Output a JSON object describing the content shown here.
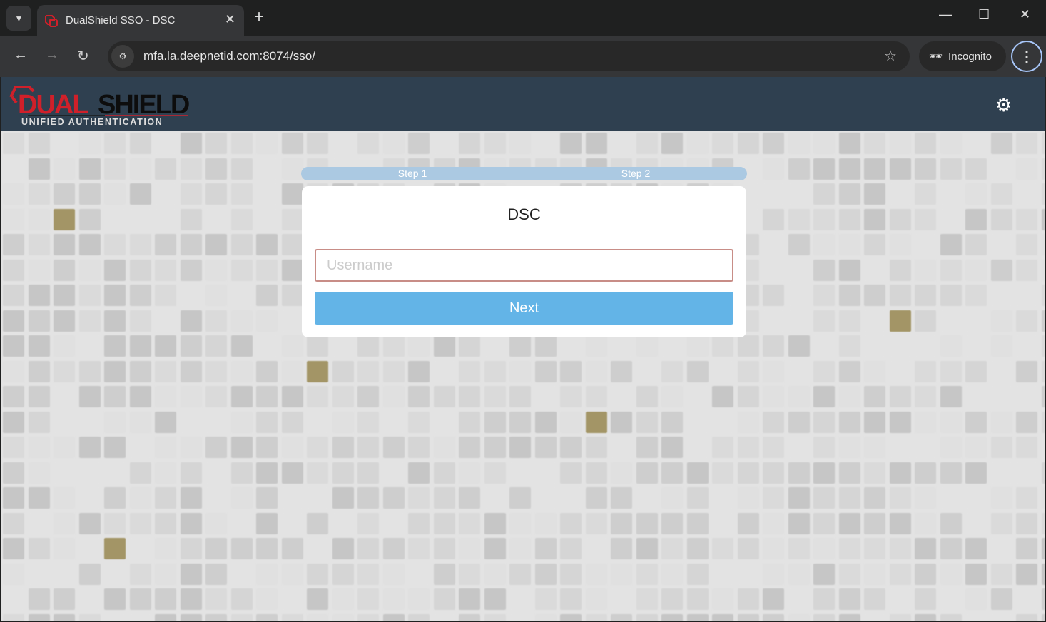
{
  "browser": {
    "tab_title": "DualShield SSO - DSC",
    "url": "mfa.la.deepnetid.com:8074/sso/",
    "incognito_label": "Incognito"
  },
  "header": {
    "logo_text": "DUALSHIELD",
    "logo_tagline": "UNIFIED AUTHENTICATION"
  },
  "steps": [
    "Step 1",
    "Step 2"
  ],
  "form": {
    "title": "DSC",
    "username_placeholder": "Username",
    "username_value": "",
    "next_label": "Next"
  },
  "colors": {
    "header": "#2f4050",
    "button": "#63b4e7",
    "accent_gold": "#a39566",
    "brand_red": "#d0202a"
  }
}
